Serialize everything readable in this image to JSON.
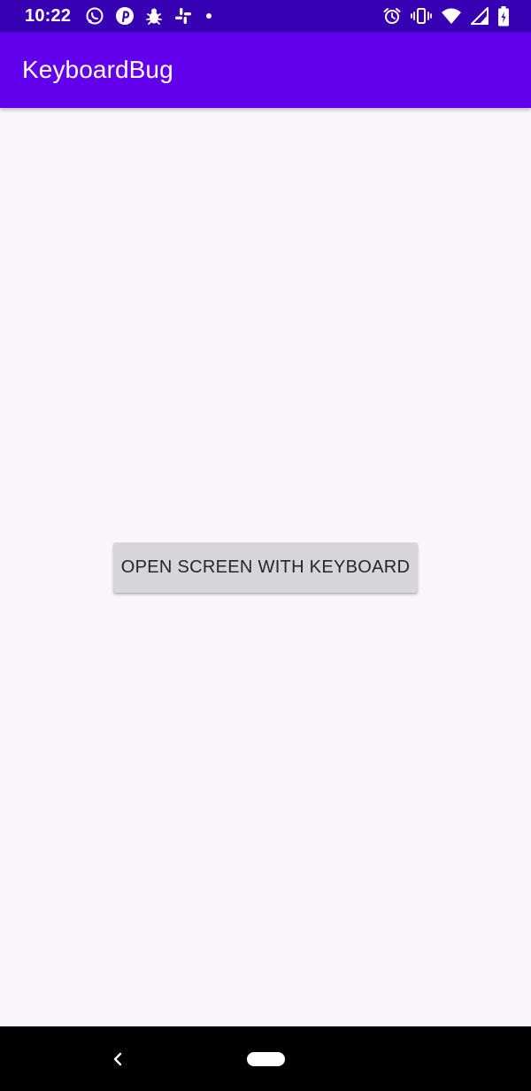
{
  "status_bar": {
    "time": "10:22",
    "notification_icons": [
      "whatsapp-icon",
      "pinterest-icon",
      "bug-icon",
      "slack-icon",
      "dot-icon"
    ],
    "system_icons": [
      "alarm-icon",
      "vibrate-icon",
      "wifi-icon",
      "signal-icon",
      "battery-icon"
    ]
  },
  "app_bar": {
    "title": "KeyboardBug"
  },
  "main": {
    "open_button_label": "OPEN SCREEN WITH KEYBOARD"
  },
  "nav_bar": {
    "buttons": [
      "back-icon",
      "home-pill"
    ]
  },
  "colors": {
    "status_bar": "#3700b3",
    "app_bar": "#6200ee",
    "background": "#f8f6f9",
    "button": "#d6d5d7",
    "nav_bar": "#000000"
  }
}
